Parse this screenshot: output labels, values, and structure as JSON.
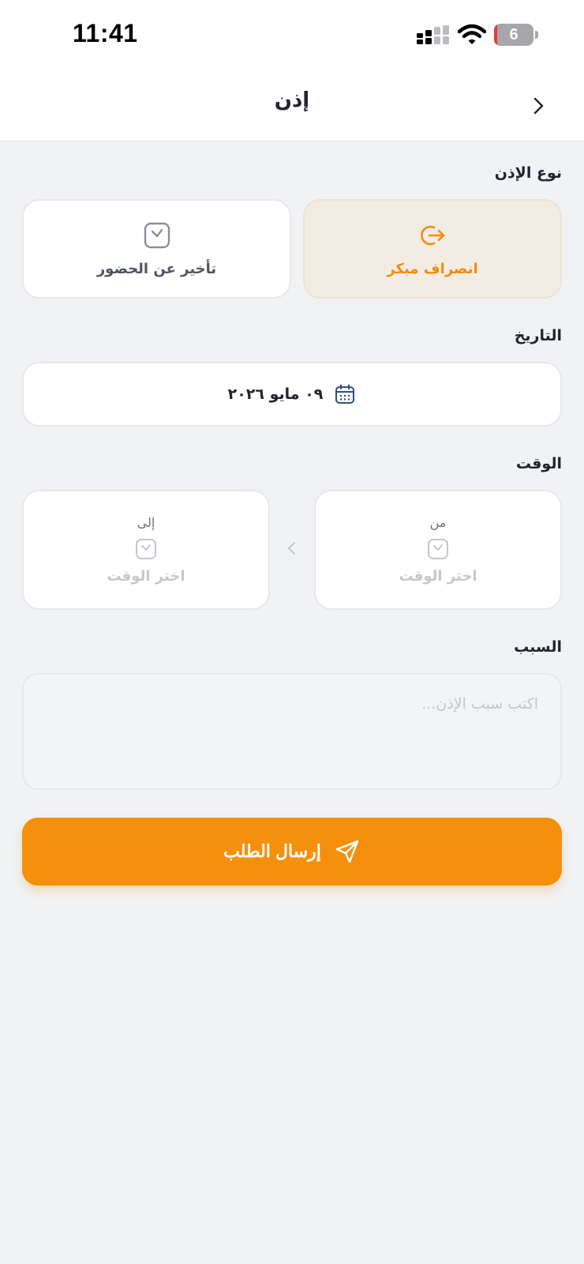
{
  "status_bar": {
    "time": "11:41",
    "battery_level": "6"
  },
  "nav": {
    "title": "إذن",
    "back_icon": "chevron-right-icon"
  },
  "permission_type": {
    "label": "نوع الإذن",
    "options": [
      {
        "label": "انصراف مبكر",
        "icon": "logout-icon",
        "selected": true
      },
      {
        "label": "تأخير عن الحضور",
        "icon": "clock-icon",
        "selected": false
      }
    ]
  },
  "date": {
    "label": "التاريخ",
    "value": "٠٩ مايو ٢٠٢٦",
    "icon": "calendar-icon"
  },
  "time": {
    "label": "الوقت",
    "from": {
      "caption": "من",
      "placeholder": "اختر الوقت"
    },
    "to": {
      "caption": "إلى",
      "placeholder": "اختر الوقت"
    }
  },
  "reason": {
    "label": "السبب",
    "placeholder": "اكتب سبب الإذن...",
    "value": ""
  },
  "submit": {
    "label": "إرسال الطلب",
    "icon": "send-icon"
  },
  "colors": {
    "accent": "#F5900C",
    "accent_text": "#F28C0F",
    "selected_card_bg": "#F3ECE3",
    "background": "#F1F2F4",
    "calendar_icon": "#2F4F86"
  }
}
